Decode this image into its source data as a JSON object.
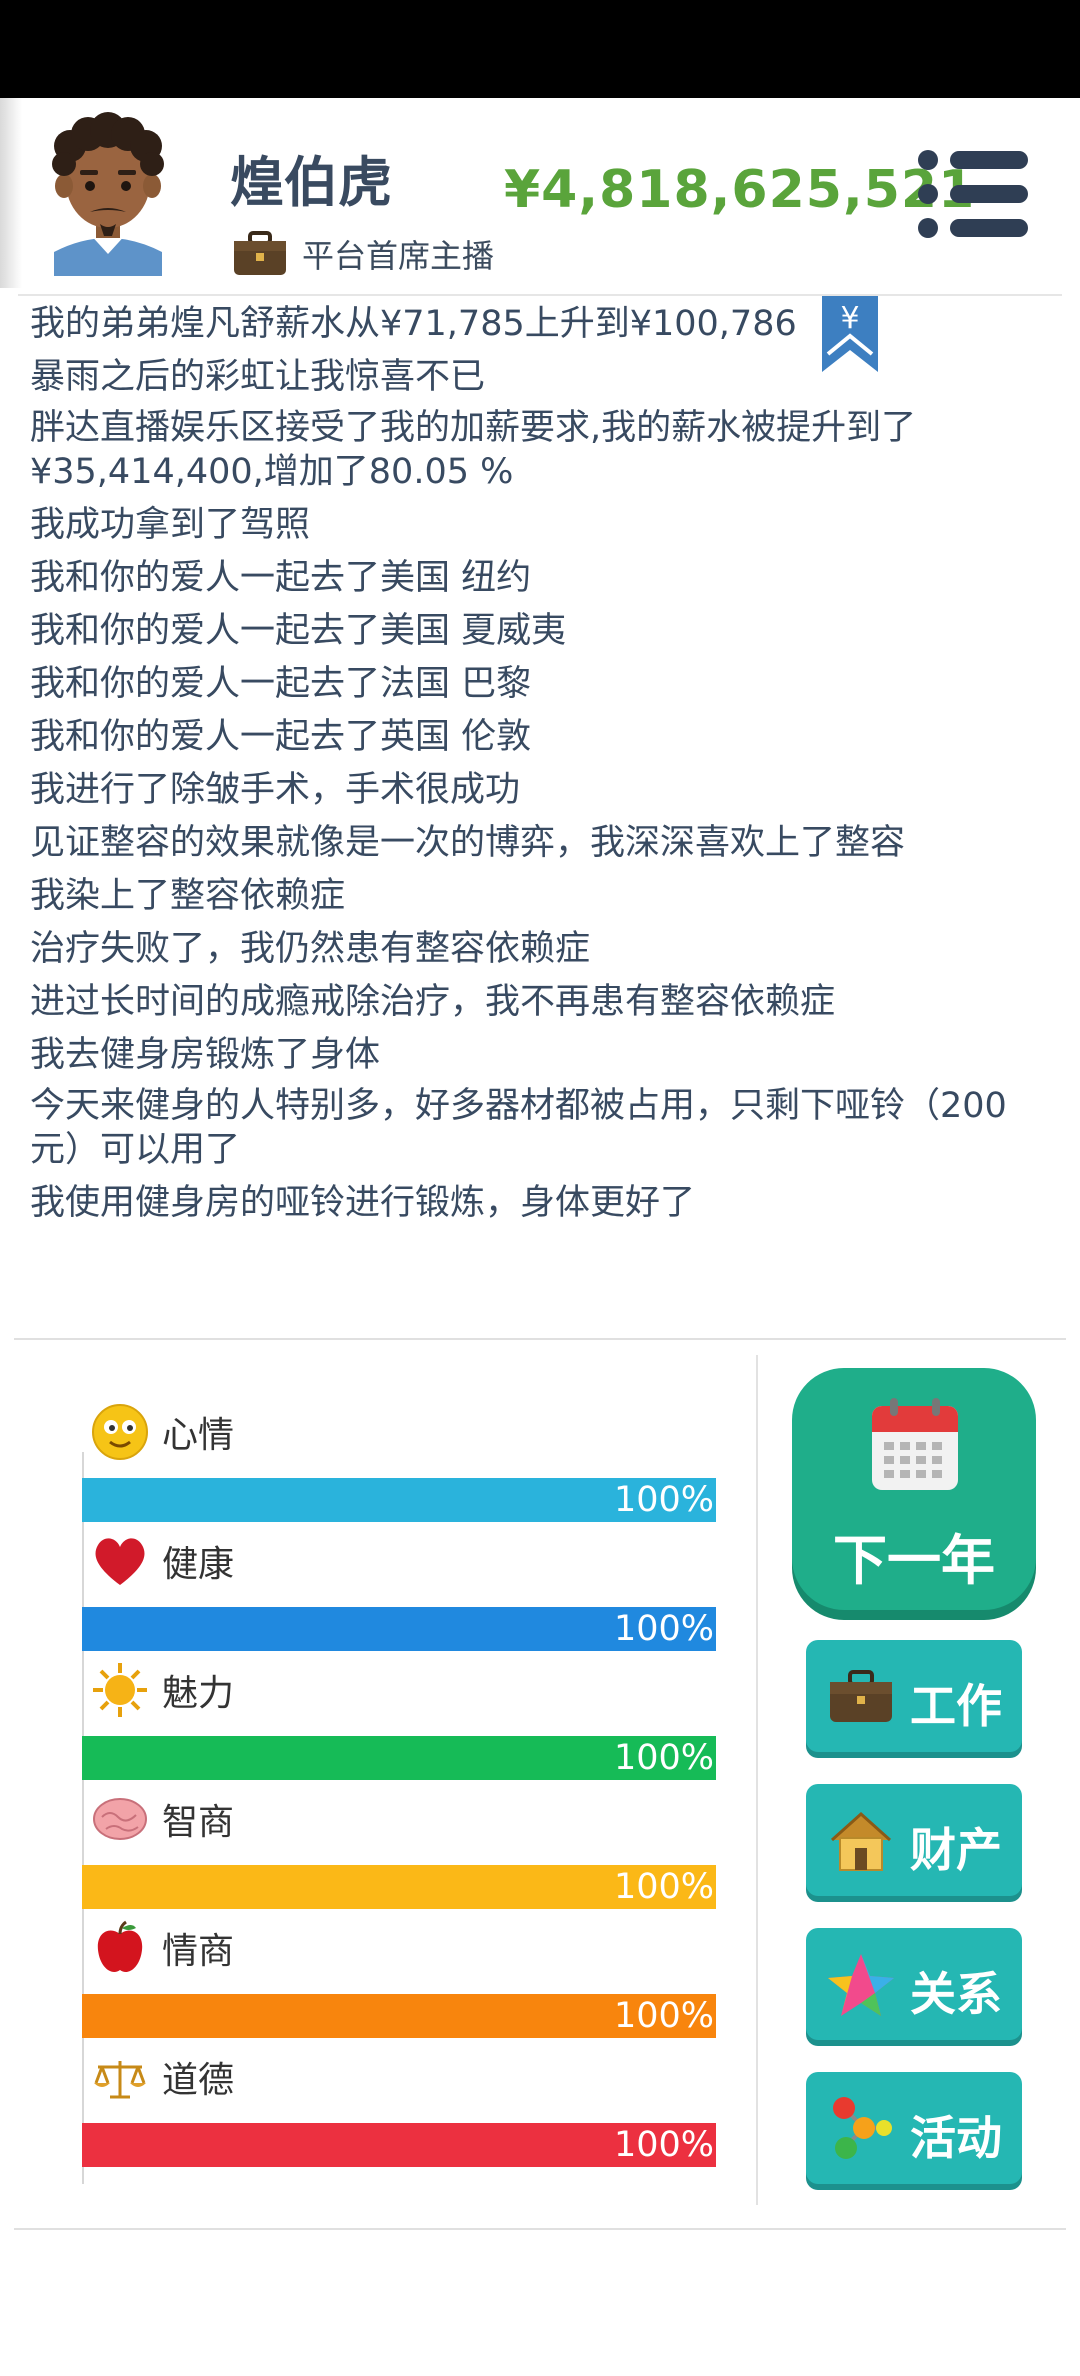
{
  "player": {
    "name": "煌伯虎",
    "job_icon": "briefcase-icon",
    "job_title": "平台首席主播",
    "money": "¥4,818,625,521",
    "money_color": "#5aa43b"
  },
  "log": [
    "我的弟弟煌凡舒薪水从¥71,785上升到¥100,786",
    "暴雨之后的彩虹让我惊喜不已",
    "胖达直播娱乐区接受了我的加薪要求,我的薪水被提升到了¥35,414,400,增加了80.05 %",
    "我成功拿到了驾照",
    "我和你的爱人一起去了美国 纽约",
    "我和你的爱人一起去了美国 夏威夷",
    "我和你的爱人一起去了法国 巴黎",
    "我和你的爱人一起去了英国 伦敦",
    "我进行了除皱手术，手术很成功",
    "见证整容的效果就像是一次的博弈，我深深喜欢上了整容",
    "我染上了整容依赖症",
    "治疗失败了，我仍然患有整容依赖症",
    "进过长时间的成瘾戒除治疗，我不再患有整容依赖症",
    "我去健身房锻炼了身体",
    "今天来健身的人特别多，好多器材都被占用，只剩下哑铃（200元）可以用了",
    "我使用健身房的哑铃进行锻炼，身体更好了"
  ],
  "bookmark_symbol": "¥",
  "stats": [
    {
      "label": "心情",
      "icon": "smiley-icon",
      "value": 100,
      "display": "100%",
      "color": "#2ab3dc"
    },
    {
      "label": "健康",
      "icon": "heart-icon",
      "value": 100,
      "display": "100%",
      "color": "#2089df"
    },
    {
      "label": "魅力",
      "icon": "sun-icon",
      "value": 100,
      "display": "100%",
      "color": "#16bb57"
    },
    {
      "label": "智商",
      "icon": "brain-icon",
      "value": 100,
      "display": "100%",
      "color": "#fbb817"
    },
    {
      "label": "情商",
      "icon": "apple-icon",
      "value": 100,
      "display": "100%",
      "color": "#f8850d"
    },
    {
      "label": "道德",
      "icon": "scales-icon",
      "value": 100,
      "display": "100%",
      "color": "#ec3040"
    }
  ],
  "next_year": {
    "label": "下一年",
    "icon": "calendar-icon"
  },
  "actions": [
    {
      "label": "工作",
      "icon": "briefcase-icon"
    },
    {
      "label": "财产",
      "icon": "house-icon"
    },
    {
      "label": "关系",
      "icon": "star-icon"
    },
    {
      "label": "活动",
      "icon": "molecule-icon"
    }
  ]
}
